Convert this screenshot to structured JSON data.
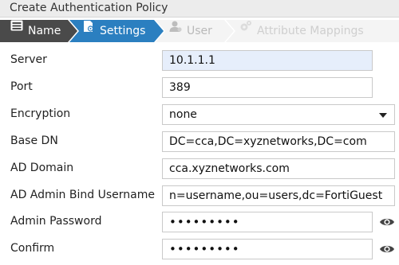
{
  "window": {
    "title": "Create Authentication Policy"
  },
  "wizard": {
    "steps": [
      {
        "label": "Name",
        "icon": "card-icon",
        "state": "done"
      },
      {
        "label": "Settings",
        "icon": "settings-doc-icon",
        "state": "active"
      },
      {
        "label": "User",
        "icon": "user-icon",
        "state": "pending"
      },
      {
        "label": "Attribute Mappings",
        "icon": "cogs-icon",
        "state": "pending"
      }
    ]
  },
  "form": {
    "server": {
      "label": "Server",
      "value": "10.1.1.1"
    },
    "port": {
      "label": "Port",
      "value": "389"
    },
    "encryption": {
      "label": "Encryption",
      "value": "none"
    },
    "base_dn": {
      "label": "Base DN",
      "value": "DC=cca,DC=xyznetworks,DC=com"
    },
    "ad_domain": {
      "label": "AD Domain",
      "value": "cca.xyznetworks.com"
    },
    "ad_admin_bind_username": {
      "label": "AD Admin Bind Username",
      "value": "n=username,ou=users,dc=FortiGuest"
    },
    "admin_password": {
      "label": "Admin Password",
      "value": "•••••••••"
    },
    "confirm": {
      "label": "Confirm",
      "value": "•••••••••"
    }
  },
  "colors": {
    "wizard_done": "#4a4a4a",
    "wizard_active": "#2b7fc0",
    "wizard_pending": "#f4f4f4",
    "field_highlight": "#e6eefb"
  }
}
